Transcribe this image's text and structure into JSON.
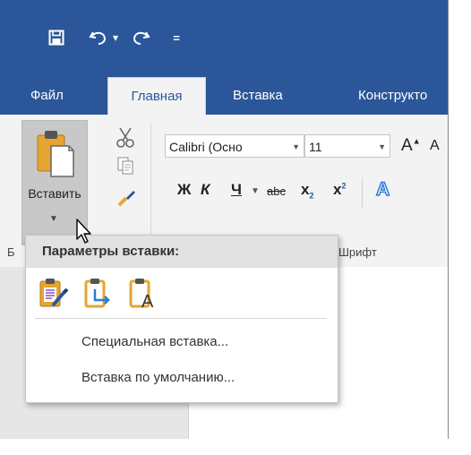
{
  "qat": {
    "save_icon": "save-icon",
    "undo_icon": "undo-icon",
    "undo_dd": "▾",
    "redo_icon": "redo-icon",
    "customize": "="
  },
  "tabs": [
    {
      "label": "Файл"
    },
    {
      "label": "Главная"
    },
    {
      "label": "Вставка"
    },
    {
      "label": "Конструкто"
    }
  ],
  "clipboard": {
    "paste_label": "Вставить",
    "group_label": "Б"
  },
  "font": {
    "family": "Calibri (Осно",
    "size": "11",
    "grow": "A",
    "shrink": "A",
    "bold": "Ж",
    "italic": "К",
    "underline": "Ч",
    "strike": "abc",
    "subscript": "x",
    "sub_mark": "2",
    "superscript": "x",
    "sup_mark": "2",
    "effects": "A",
    "group_label": "Шрифт"
  },
  "popup": {
    "title": "Параметры вставки:",
    "items": [
      {
        "label": "Специальная вставка..."
      },
      {
        "label": "Вставка по умолчанию..."
      }
    ]
  },
  "colors": {
    "title_bar": "#2b579a",
    "ribbon": "#f3f3f3",
    "paste_button_pressed": "#c8c8c8"
  }
}
